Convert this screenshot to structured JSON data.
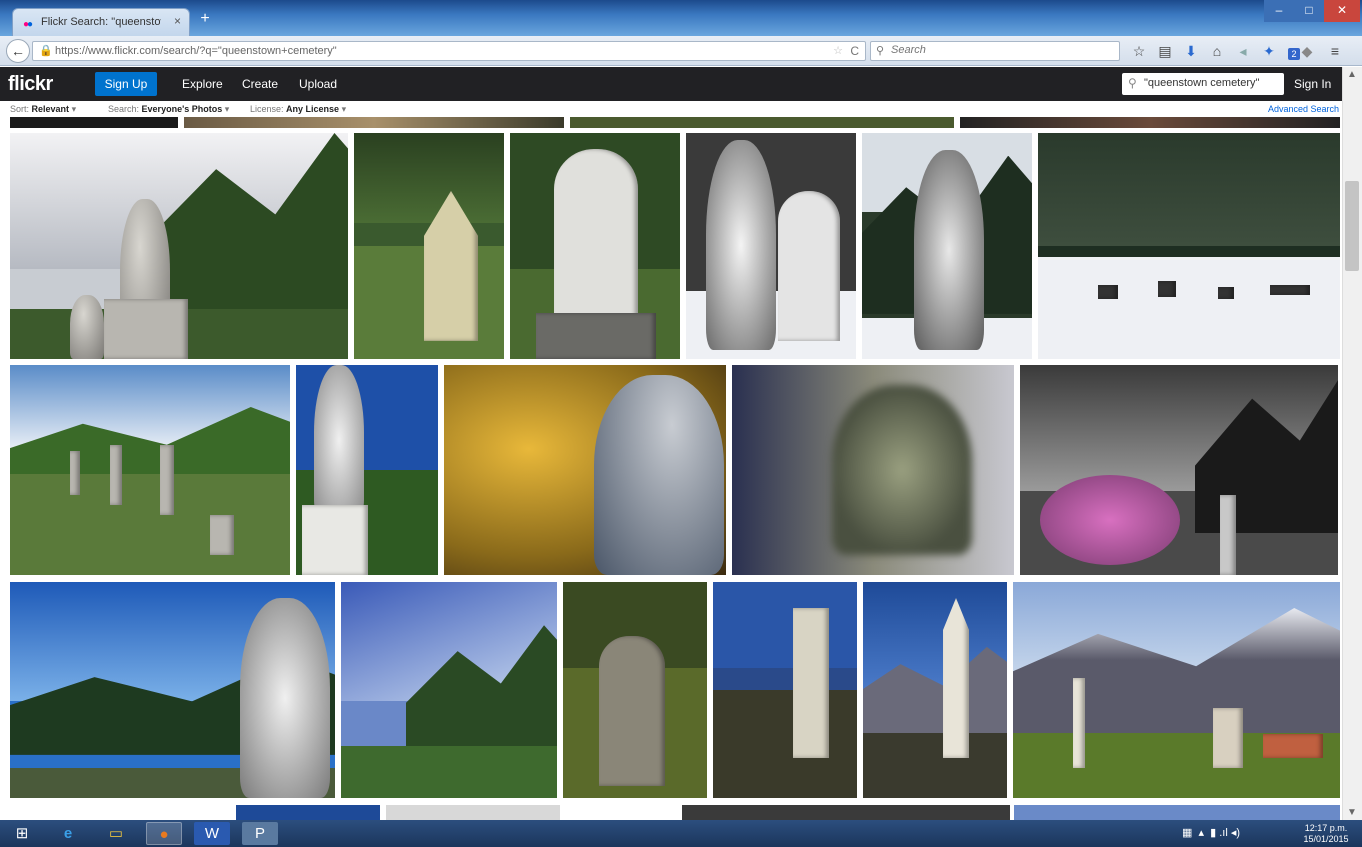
{
  "browser": {
    "tab_title": "Flickr Search: \"queenstown...",
    "tab_close": "×",
    "new_tab": "+",
    "back": "←",
    "url": "https://www.flickr.com/search/?q=\"queenstown+cemetery\"",
    "search_placeholder": "Search",
    "reload": "C",
    "star": "☆",
    "win_min": "–",
    "win_max": "□",
    "win_close": "✕",
    "badge_count": "2"
  },
  "flickr": {
    "logo": "flickr",
    "signup": "Sign Up",
    "nav": [
      "Explore",
      "Create",
      "Upload"
    ],
    "search_value": "\"queenstown cemetery\"",
    "signin": "Sign In"
  },
  "filters": {
    "sort_label": "Sort:",
    "sort_value": "Relevant",
    "search_label": "Search:",
    "search_value": "Everyone's Photos",
    "license_label": "License:",
    "license_value": "Any License",
    "advanced": "Advanced Search"
  },
  "taskbar": {
    "clock_time": "12:17 p.m.",
    "clock_date": "15/01/2015"
  },
  "colors": {
    "flickr_blue": "#0073ce",
    "flickr_header": "#212124",
    "link_blue": "#0063dc"
  }
}
